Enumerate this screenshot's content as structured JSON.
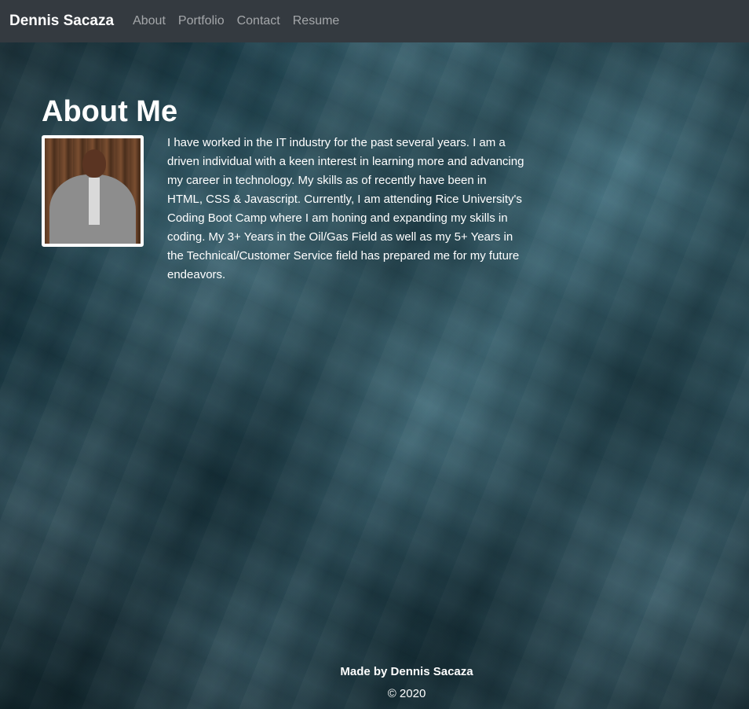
{
  "nav": {
    "brand": "Dennis Sacaza",
    "links": [
      "About",
      "Portfolio",
      "Contact",
      "Resume"
    ]
  },
  "about": {
    "heading": "About Me",
    "bio": "I have worked in the IT industry for the past several years. I am a driven individual with a keen interest in learning more and advancing my career in technology. My skills as of recently have been in HTML, CSS & Javascript. Currently, I am attending Rice University's Coding Boot Camp where I am honing and expanding my skills in coding. My 3+ Years in the Oil/Gas Field as well as my 5+ Years in the Technical/Customer Service field has prepared me for my future endeavors."
  },
  "footer": {
    "made_by": "Made by Dennis Sacaza",
    "copyright": "© 2020"
  },
  "colors": {
    "navbar": "#343a40",
    "nav_link": "rgba(255,255,255,0.55)",
    "text": "#ffffff",
    "background": "#1c3f4b"
  }
}
